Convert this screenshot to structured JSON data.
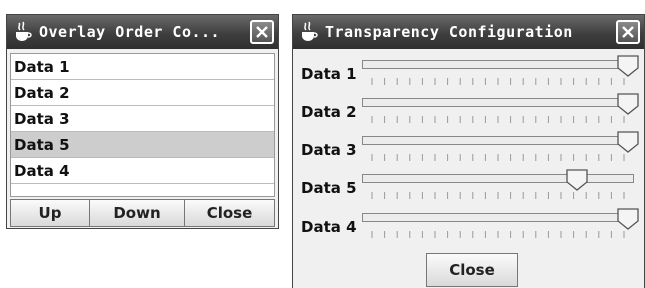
{
  "overlay_window": {
    "title": "Overlay Order Co...",
    "items": [
      {
        "label": "Data 1",
        "selected": false
      },
      {
        "label": "Data 2",
        "selected": false
      },
      {
        "label": "Data 3",
        "selected": false
      },
      {
        "label": "Data 5",
        "selected": true
      },
      {
        "label": "Data 4",
        "selected": false
      }
    ],
    "buttons": {
      "up": "Up",
      "down": "Down",
      "close": "Close"
    }
  },
  "transparency_window": {
    "title": "Transparency Configuration",
    "sliders": [
      {
        "label": "Data 1",
        "value": 1.0
      },
      {
        "label": "Data 2",
        "value": 1.0
      },
      {
        "label": "Data 3",
        "value": 1.0
      },
      {
        "label": "Data 5",
        "value": 0.8
      },
      {
        "label": "Data 4",
        "value": 1.0
      }
    ],
    "close_label": "Close"
  },
  "icons": {
    "title_icon": "java-cup-icon",
    "close_icon": "close-icon"
  }
}
